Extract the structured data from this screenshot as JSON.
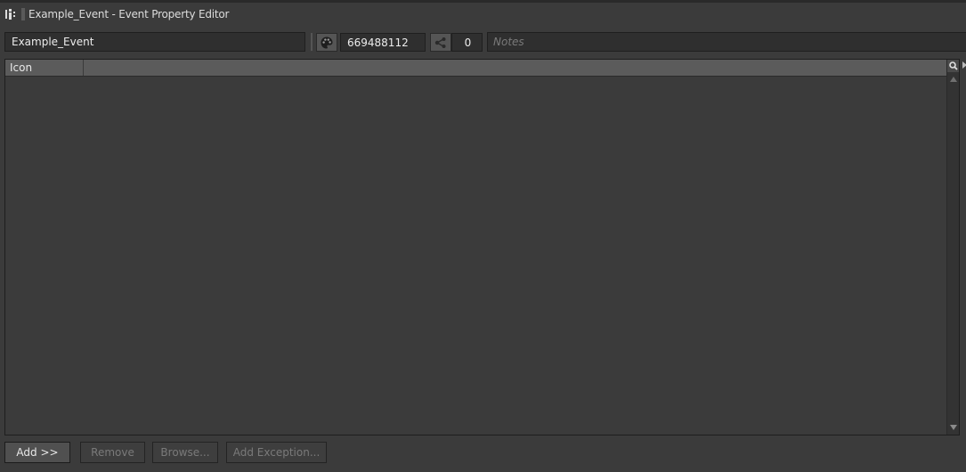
{
  "window": {
    "title": "Example_Event - Event Property Editor"
  },
  "toolbar": {
    "name_value": "Example_Event",
    "id_value": "669488112",
    "reference_count": "0",
    "notes_placeholder": "Notes"
  },
  "list": {
    "columns": [
      "Icon"
    ],
    "rows": []
  },
  "buttons": {
    "add": "Add >>",
    "remove": "Remove",
    "browse": "Browse...",
    "add_exception": "Add Exception..."
  }
}
